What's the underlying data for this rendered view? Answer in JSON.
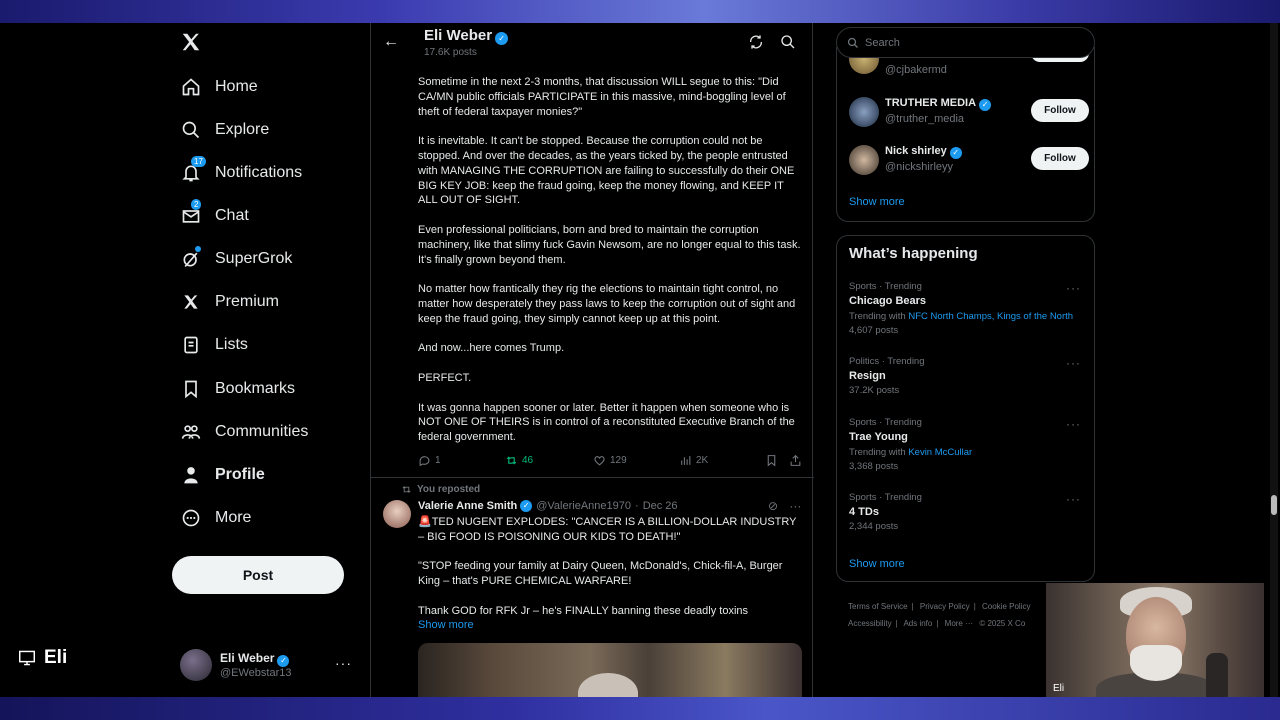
{
  "nav": {
    "items": [
      {
        "label": "Home",
        "icon": "home-icon"
      },
      {
        "label": "Explore",
        "icon": "search-icon"
      },
      {
        "label": "Notifications",
        "icon": "bell-icon",
        "badge": "17"
      },
      {
        "label": "Chat",
        "icon": "mail-icon",
        "badge": "2"
      },
      {
        "label": "SuperGrok",
        "icon": "grok-icon"
      },
      {
        "label": "Premium",
        "icon": "x-logo-icon"
      },
      {
        "label": "Lists",
        "icon": "list-icon"
      },
      {
        "label": "Bookmarks",
        "icon": "bookmark-icon"
      },
      {
        "label": "Communities",
        "icon": "communities-icon"
      },
      {
        "label": "Profile",
        "icon": "person-icon"
      },
      {
        "label": "More",
        "icon": "more-circle-icon"
      }
    ],
    "post_label": "Post",
    "account": {
      "name": "Eli Weber",
      "handle": "@EWebstar13"
    }
  },
  "screen_label": "Eli",
  "header": {
    "name": "Eli Weber",
    "post_count": "17.6K posts"
  },
  "tweet1": {
    "paragraphs": [
      "Sometime in the next 2-3 months, that discussion WILL segue to this: \"Did CA/MN public officials PARTICIPATE in this massive, mind-boggling level of theft of federal taxpayer monies?\"",
      "It is inevitable. It can't be stopped.  Because the corruption could not be stopped. And over the decades, as the years ticked by, the people entrusted with MANAGING THE CORRUPTION are failing to successfully do their ONE BIG KEY JOB: keep the fraud going, keep the money flowing, and KEEP IT ALL OUT OF SIGHT.",
      "Even professional politicians, born and bred to maintain the corruption machinery, like that slimy fuck Gavin Newsom, are no longer equal to this task.  It's finally grown beyond them.",
      "No matter how frantically they rig the elections to maintain tight control, no matter how desperately they pass laws to keep the corruption out of sight and keep the fraud going, they simply cannot keep up at this point.",
      "And now...here comes Trump.",
      "PERFECT.",
      "It was gonna happen sooner or later. Better it happen when someone who is NOT ONE OF THEIRS is in control of a reconstituted Executive Branch of the federal government."
    ],
    "replies": "1",
    "reposts": "46",
    "likes": "129",
    "views": "2K"
  },
  "tweet2": {
    "repost_label": "You reposted",
    "name": "Valerie Anne Smith",
    "handle": "@ValerieAnne1970",
    "date": "Dec 26",
    "paragraphs": [
      "🚨TED NUGENT EXPLODES: \"CANCER IS A BILLION-DOLLAR INDUSTRY – BIG FOOD IS POISONING OUR KIDS TO DEATH!\"",
      "\"STOP feeding your family at Dairy Queen, McDonald's, Chick-fil-A, Burger King – that's PURE CHEMICAL WARFARE!",
      "Thank GOD for RFK Jr – he's FINALLY banning these deadly toxins"
    ],
    "show_more": "Show more"
  },
  "search": {
    "placeholder": "Search"
  },
  "who_to_follow": {
    "items": [
      {
        "name": "",
        "handle": "@cjbakermd",
        "follow": "Follow"
      },
      {
        "name": "TRUTHER MEDIA",
        "handle": "@truther_media",
        "follow": "Follow"
      },
      {
        "name": "Nick shirley",
        "handle": "@nickshirleyy",
        "follow": "Follow"
      }
    ],
    "show_more": "Show more"
  },
  "happening": {
    "title": "What’s happening",
    "trends": [
      {
        "category": "Sports · Trending",
        "name": "Chicago Bears",
        "with_label": "Trending with",
        "with": "NFC North Champs, Kings of the North",
        "posts": "4,607 posts"
      },
      {
        "category": "Politics · Trending",
        "name": "Resign",
        "with_label": "",
        "with": "",
        "posts": "37.2K posts"
      },
      {
        "category": "Sports · Trending",
        "name": "Trae Young",
        "with_label": "Trending with",
        "with": "Kevin McCullar",
        "posts": "3,368 posts"
      },
      {
        "category": "Sports · Trending",
        "name": "4 TDs",
        "with_label": "",
        "with": "",
        "posts": "2,344 posts"
      }
    ],
    "show_more": "Show more"
  },
  "footer": {
    "links": [
      "Terms of Service",
      "|",
      "Privacy Policy",
      "|",
      "Cookie Policy",
      "Accessibility",
      "|",
      "Ads info",
      "|",
      "More ···",
      "© 2025 X Co"
    ]
  },
  "webcam": {
    "label": "Eli"
  },
  "colors": {
    "accent": "#1d9bf0",
    "repost_green": "#00ba7c",
    "border": "#2f3336",
    "muted": "#71767b"
  }
}
